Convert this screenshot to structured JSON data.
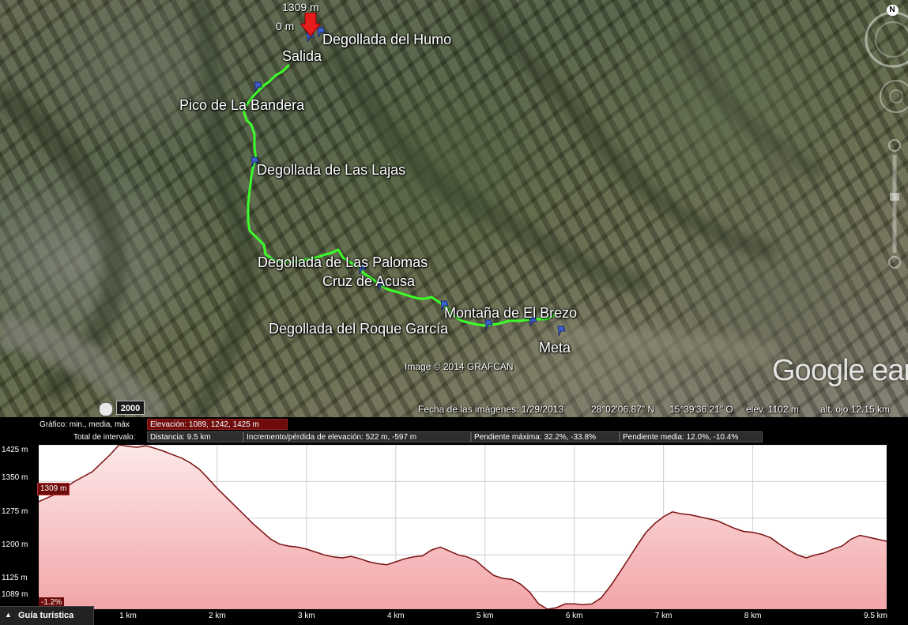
{
  "map": {
    "top_marker": {
      "elevation": "1309 m",
      "distance": "0 m"
    },
    "waypoints": [
      {
        "name": "Degollada del Humo"
      },
      {
        "name": "Salida"
      },
      {
        "name": "Pico de La Bandera"
      },
      {
        "name": "Degollada de Las Lajas"
      },
      {
        "name": "Degollada de Las Palomas"
      },
      {
        "name": "Cruz de Acusa"
      },
      {
        "name": "Montaña de El Brezo"
      },
      {
        "name": "Degollada del Roque García"
      },
      {
        "name": "Meta"
      }
    ],
    "credit": "Image © 2014 GRAFCAN",
    "logo": "Google earth",
    "historical_year": "2000",
    "north_label": "N",
    "route_color": "#3cff2a",
    "icons": [
      "clock-icon",
      "compass-icon",
      "look-joystick-icon",
      "move-joystick-icon",
      "zoom-slider-icon",
      "placemark-pin-icon"
    ]
  },
  "status": {
    "imagery_date": "Fecha de las imágenes: 1/29/2013",
    "lat": "28°02'06.87\" N",
    "lon": "15°39'36.21\" O",
    "elev": "elev.  1102 m",
    "eye_alt": "alt. ojo  12.15 km"
  },
  "panel": {
    "graph_label": "Gráfico: min., media, máx",
    "elevation_cell": "Elevación: 1089, 1242, 1425 m",
    "interval_label": "Total de intervalo:",
    "distance_cell": "Distancia: 9.5 km",
    "gain_cell": "Incremento/pérdida de elevación: 522 m, -597 m",
    "max_slope_cell": "Pendiente máxima: 32.2%, -33.8%",
    "avg_slope_cell": "Pendiente media: 12.0%, -10.4%",
    "cursor_elev": "1309 m",
    "cursor_slope": "-1.2%",
    "tour_button": "Guía turística"
  },
  "chart_data": {
    "type": "area",
    "title": "",
    "xlabel": "",
    "ylabel": "",
    "x_unit": "km",
    "xlim": [
      0,
      9.5
    ],
    "ylim": [
      1089,
      1425
    ],
    "y_ticks": [
      "1425 m",
      "1350 m",
      "1275 m",
      "1200 m",
      "1125 m",
      "1089 m"
    ],
    "y_tick_values": [
      1425,
      1350,
      1275,
      1200,
      1125,
      1089
    ],
    "x_ticks": [
      "1 km",
      "2 km",
      "3 km",
      "4 km",
      "5 km",
      "6 km",
      "7 km",
      "8 km",
      "9.5 km"
    ],
    "x_tick_values": [
      1,
      2,
      3,
      4,
      5,
      6,
      7,
      8,
      9.5
    ],
    "grid": true,
    "fill_color": "#f2a5a8",
    "line_color": "#7a1010",
    "series": [
      {
        "x": [
          0,
          0.2,
          0.4,
          0.6,
          0.8,
          0.9,
          1.0,
          1.1,
          1.2,
          1.3,
          1.4,
          1.5,
          1.6,
          1.7,
          1.8,
          1.9,
          2.0,
          2.1,
          2.2,
          2.3,
          2.4,
          2.5,
          2.6,
          2.7,
          2.8,
          2.9,
          3.0,
          3.1,
          3.2,
          3.3,
          3.4,
          3.5,
          3.6,
          3.7,
          3.8,
          3.9,
          4.0,
          4.1,
          4.2,
          4.3,
          4.4,
          4.5,
          4.6,
          4.7,
          4.8,
          4.9,
          5.0,
          5.1,
          5.2,
          5.3,
          5.4,
          5.5,
          5.6,
          5.7,
          5.8,
          5.9,
          6.0,
          6.1,
          6.2,
          6.3,
          6.4,
          6.5,
          6.6,
          6.7,
          6.8,
          6.9,
          7.0,
          7.1,
          7.2,
          7.3,
          7.4,
          7.5,
          7.6,
          7.7,
          7.8,
          7.9,
          8.0,
          8.1,
          8.2,
          8.3,
          8.4,
          8.5,
          8.6,
          8.7,
          8.8,
          8.9,
          9.0,
          9.1,
          9.2,
          9.3,
          9.4,
          9.5
        ],
        "values": [
          1309,
          1325,
          1350,
          1370,
          1405,
          1425,
          1422,
          1420,
          1423,
          1418,
          1412,
          1405,
          1398,
          1388,
          1375,
          1356,
          1336,
          1318,
          1300,
          1282,
          1264,
          1248,
          1232,
          1222,
          1218,
          1216,
          1212,
          1206,
          1200,
          1196,
          1194,
          1197,
          1192,
          1186,
          1182,
          1180,
          1186,
          1192,
          1196,
          1198,
          1210,
          1216,
          1208,
          1200,
          1196,
          1188,
          1172,
          1158,
          1152,
          1150,
          1140,
          1124,
          1100,
          1089,
          1092,
          1100,
          1100,
          1098,
          1100,
          1112,
          1135,
          1162,
          1190,
          1218,
          1245,
          1264,
          1278,
          1288,
          1284,
          1282,
          1278,
          1274,
          1270,
          1262,
          1254,
          1248,
          1246,
          1242,
          1235,
          1222,
          1210,
          1200,
          1194,
          1200,
          1204,
          1212,
          1218,
          1232,
          1240,
          1236,
          1232,
          1228
        ]
      }
    ]
  }
}
